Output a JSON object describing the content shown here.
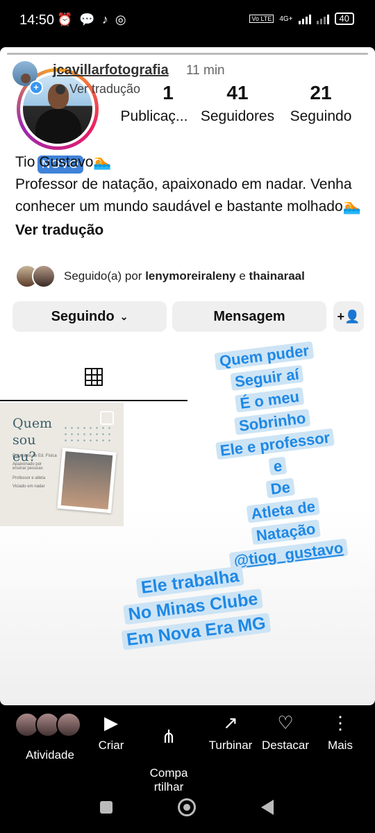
{
  "status_bar": {
    "time": "14:50",
    "network": "4G+",
    "volte": "Vo LTE",
    "battery": "40"
  },
  "story": {
    "author": "jcavillarfotografia",
    "time_ago": "11 min",
    "translate_hint": "Ver tradução"
  },
  "profile": {
    "badge": "NOVO",
    "stats": [
      {
        "value": "1",
        "label": "Publicaç..."
      },
      {
        "value": "41",
        "label": "Seguidores"
      },
      {
        "value": "21",
        "label": "Seguindo"
      }
    ],
    "name": "Tio Gustavo🏊",
    "bio": "Professor de natação, apaixonado em nadar. Venha conhecer um mundo saudável e bastante molhado🏊",
    "translate": "Ver tradução",
    "followed_by_prefix": "Seguido(a) por",
    "followed_by_user1": "lenymoreiraleny",
    "followed_by_and": "e",
    "followed_by_user2": "thainaraal",
    "buttons": {
      "following": "Seguindo",
      "message": "Mensagem"
    }
  },
  "post": {
    "title": "Quem sou eu?",
    "items": [
      "Estudante de Ed. Física",
      "Apaixonado por ensinar pessoas",
      "Professor e atleta",
      "Viciado em nadar"
    ]
  },
  "overlay1": {
    "lines": [
      "Quem puder",
      "Seguir aí",
      "É o meu",
      "Sobrinho",
      "Ele e professor",
      "e",
      "De",
      "Atleta de",
      "Natação"
    ],
    "mention": "@tiog_gustavo"
  },
  "overlay2": {
    "lines": [
      "Ele trabalha",
      "No Minas Clube",
      "Em Nova Era MG"
    ]
  },
  "actions": [
    {
      "label": "Atividade",
      "icon": "activity-avatars"
    },
    {
      "label": "Criar",
      "icon": "reels-icon"
    },
    {
      "label": "Compa\nrtilhar",
      "icon": "share-icon"
    },
    {
      "label": "Turbinar",
      "icon": "boost-icon"
    },
    {
      "label": "Destacar",
      "icon": "highlight-icon"
    },
    {
      "label": "Mais",
      "icon": "more-icon"
    }
  ]
}
